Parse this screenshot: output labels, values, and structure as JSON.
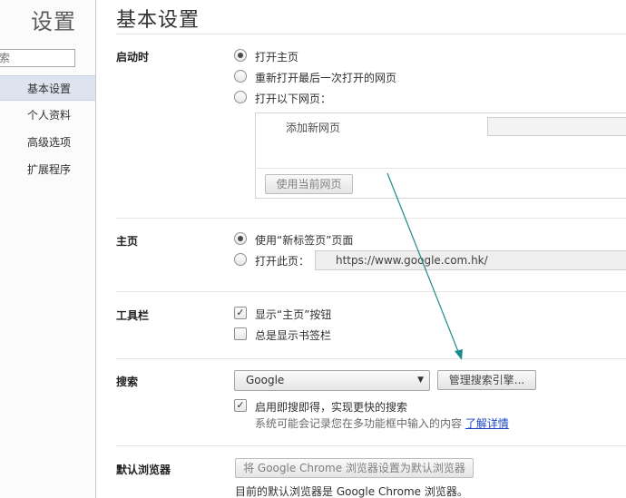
{
  "sidebar": {
    "title": "设置",
    "search_placeholder": "索",
    "items": [
      {
        "label": "基本设置",
        "selected": true
      },
      {
        "label": "个人资料",
        "selected": false
      },
      {
        "label": "高级选项",
        "selected": false
      },
      {
        "label": "扩展程序",
        "selected": false
      }
    ]
  },
  "main": {
    "title": "基本设置",
    "startup": {
      "label": "启动时",
      "options": [
        "打开主页",
        "重新打开最后一次打开的网页",
        "打开以下网页："
      ],
      "selected_index": 0,
      "add_page_label": "添加新网页",
      "use_current_button": "使用当前网页"
    },
    "homepage": {
      "label": "主页",
      "option_newtab": "使用“新标签页”页面",
      "option_url": "打开此页：",
      "url_value": "https://www.google.com.hk/"
    },
    "toolbar": {
      "label": "工具栏",
      "show_home_button": "显示“主页”按钮",
      "show_home_checked": true,
      "always_show_bookmarks": "总是显示书签栏",
      "always_show_bookmarks_checked": false
    },
    "search": {
      "label": "搜索",
      "engine": "Google",
      "manage_button": "管理搜索引擎...",
      "instant_label": "启用即搜即得，实现更快的搜索",
      "instant_checked": true,
      "instant_hint": "系统可能会记录您在多功能框中输入的内容",
      "learn_more": "了解详情"
    },
    "default_browser": {
      "label": "默认浏览器",
      "set_default_button": "将 Google Chrome 浏览器设置为默认浏览器",
      "status": "目前的默认浏览器是 Google Chrome 浏览器。"
    }
  },
  "colors": {
    "sidebar_selected": "#dde4f0",
    "link": "#1a45c6",
    "annotation_arrow": "#1f8a8a"
  }
}
